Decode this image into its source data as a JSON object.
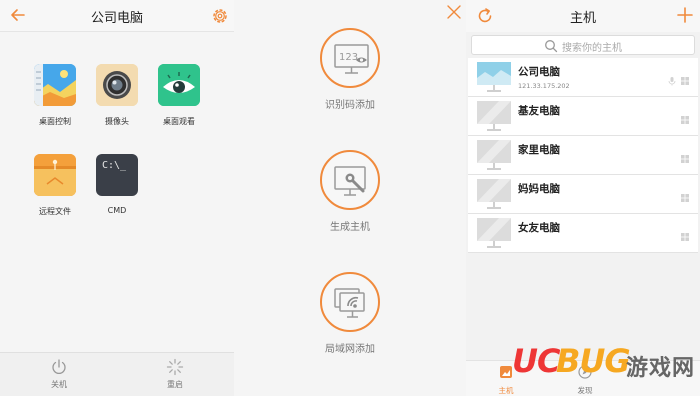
{
  "colors": {
    "accent": "#f08a3c",
    "monitor_screen": "#dcdcdc",
    "monitor_active": "#8fd0e8"
  },
  "left_panel": {
    "title": "公司电脑",
    "apps": [
      {
        "label": "桌面控制",
        "icon": "desktop-control-icon"
      },
      {
        "label": "摄像头",
        "icon": "camera-icon"
      },
      {
        "label": "桌面观看",
        "icon": "eye-icon"
      },
      {
        "label": "远程文件",
        "icon": "folder-icon"
      },
      {
        "label": "CMD",
        "icon": "terminal-icon",
        "glyph": "C:\\_"
      }
    ],
    "footer": [
      {
        "label": "关机",
        "icon": "power-icon"
      },
      {
        "label": "重启",
        "icon": "loading-icon"
      }
    ]
  },
  "middle_panel": {
    "options": [
      {
        "label": "识别码添加",
        "icon": "code-screen-icon",
        "code": "123"
      },
      {
        "label": "生成主机",
        "icon": "wrench-screen-icon"
      },
      {
        "label": "局域网添加",
        "icon": "lan-screen-icon"
      }
    ]
  },
  "right_panel": {
    "title": "主机",
    "search_placeholder": "搜索你的主机",
    "hosts": [
      {
        "name": "公司电脑",
        "ip": "121.33.175.202",
        "active": true
      },
      {
        "name": "基友电脑",
        "ip": "",
        "active": false
      },
      {
        "name": "家里电脑",
        "ip": "",
        "active": false
      },
      {
        "name": "妈妈电脑",
        "ip": "",
        "active": false
      },
      {
        "name": "女友电脑",
        "ip": "",
        "active": false
      }
    ],
    "tabs": [
      {
        "label": "主机",
        "icon": "host-icon",
        "active": true
      },
      {
        "label": "发现",
        "icon": "discover-icon",
        "active": false
      }
    ]
  },
  "watermark": {
    "logo_text": "UCBUG",
    "logo_part1": "UC",
    "logo_part2": "BUG",
    "site_text": "游戏网"
  }
}
